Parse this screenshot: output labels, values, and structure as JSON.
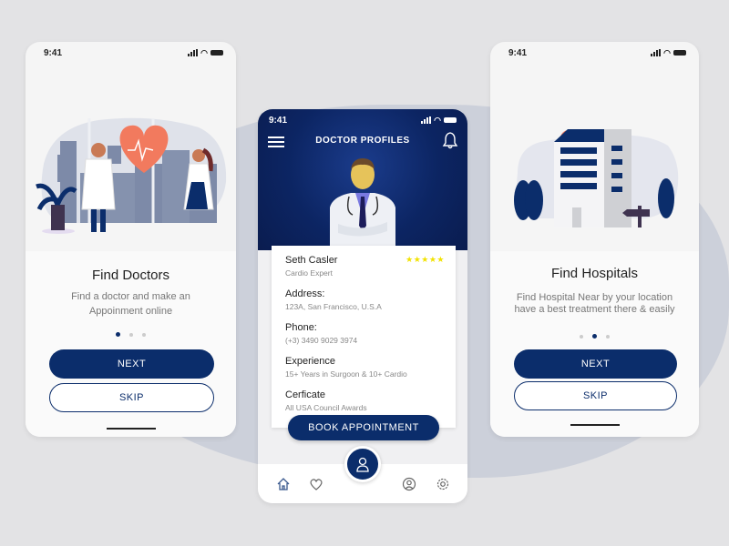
{
  "colors": {
    "primary": "#0b2d6b",
    "accent": "#f27a5e",
    "star": "#f2e200",
    "background": "#e3e3e5"
  },
  "status_time": "9:41",
  "left_screen": {
    "title": "Find Doctors",
    "description_line1": "Find a doctor and make an",
    "description_line2": "Appoinment online",
    "page_indicator": {
      "active": 1,
      "total": 3
    },
    "next_label": "NEXT",
    "skip_label": "SKIP"
  },
  "middle_screen": {
    "header_title": "DOCTOR PROFILES",
    "doctor": {
      "name": "Seth Casler",
      "specialty": "Cardio Expert",
      "rating": 5,
      "stars": "★★★★★",
      "address_label": "Address:",
      "address": "123A, San Francisco, U.S.A",
      "phone_label": "Phone:",
      "phone": "(+3) 3490 9029 3974",
      "experience_label": "Experience",
      "experience": "15+ Years in Surgoon & 10+ Cardio",
      "certificate_label": "Cerficate",
      "certificate": "All USA Council Awards"
    },
    "book_label": "BOOK APPOINTMENT",
    "tabs": [
      "home-icon",
      "heart-icon",
      "doctor-icon",
      "profile-icon",
      "settings-icon"
    ]
  },
  "right_screen": {
    "title": "Find Hospitals",
    "description_line1": "Find Hospital Near by your location",
    "description_line2": "have a best treatment there & easily",
    "page_indicator": {
      "active": 2,
      "total": 3
    },
    "next_label": "NEXT",
    "skip_label": "SKIP"
  }
}
